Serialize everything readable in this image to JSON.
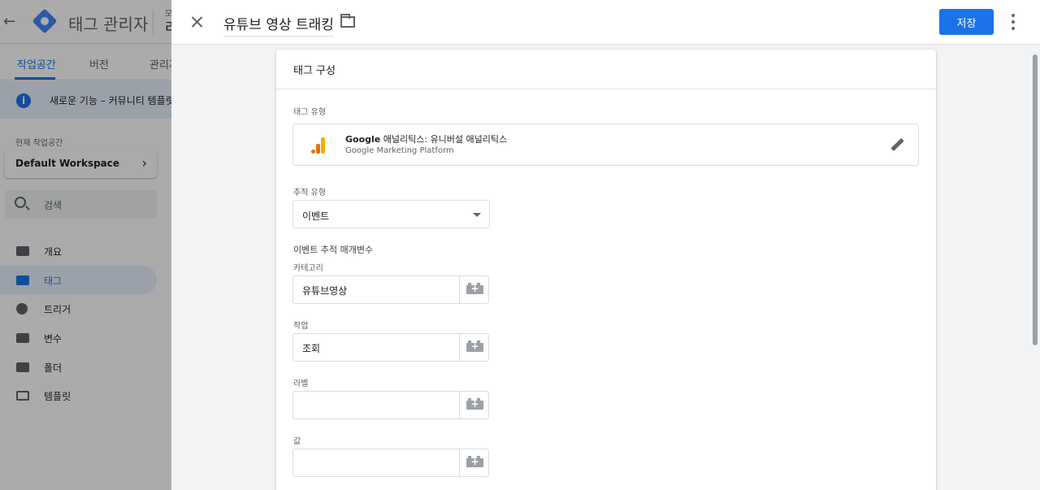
{
  "background": {
    "app_name": "태그 관리자",
    "account_small": "모",
    "account_big": "리",
    "tabs": [
      {
        "label": "작업공간"
      },
      {
        "label": "버전"
      },
      {
        "label": "관리자"
      }
    ],
    "notice": "새로운 기능 – 커뮤니티 템플릿 갤",
    "workspace_label": "현재 작업공간",
    "workspace_name": "Default Workspace",
    "search_placeholder": "검색",
    "nav": [
      {
        "label": "개요"
      },
      {
        "label": "태그"
      },
      {
        "label": "트리거"
      },
      {
        "label": "변수"
      },
      {
        "label": "폴더"
      },
      {
        "label": "템플릿"
      }
    ]
  },
  "sheet": {
    "tag_name": "유튜브 영상 트래킹",
    "save_label": "저장"
  },
  "config": {
    "title": "태그 구성",
    "tag_type_label": "태그 유형",
    "tag_type_brand": "Google",
    "tag_type_name": "애널리틱스: 유니버설 애널리틱스",
    "tag_type_platform": "Google Marketing Platform",
    "tracking_type_label": "추적 유형",
    "tracking_type_value": "이벤트",
    "event_params_label": "이벤트 추적 매개변수",
    "fields": [
      {
        "label": "카테고리",
        "value": "유튜브영상"
      },
      {
        "label": "작업",
        "value": "조회"
      },
      {
        "label": "라벨",
        "value": ""
      },
      {
        "label": "값",
        "value": ""
      }
    ]
  }
}
